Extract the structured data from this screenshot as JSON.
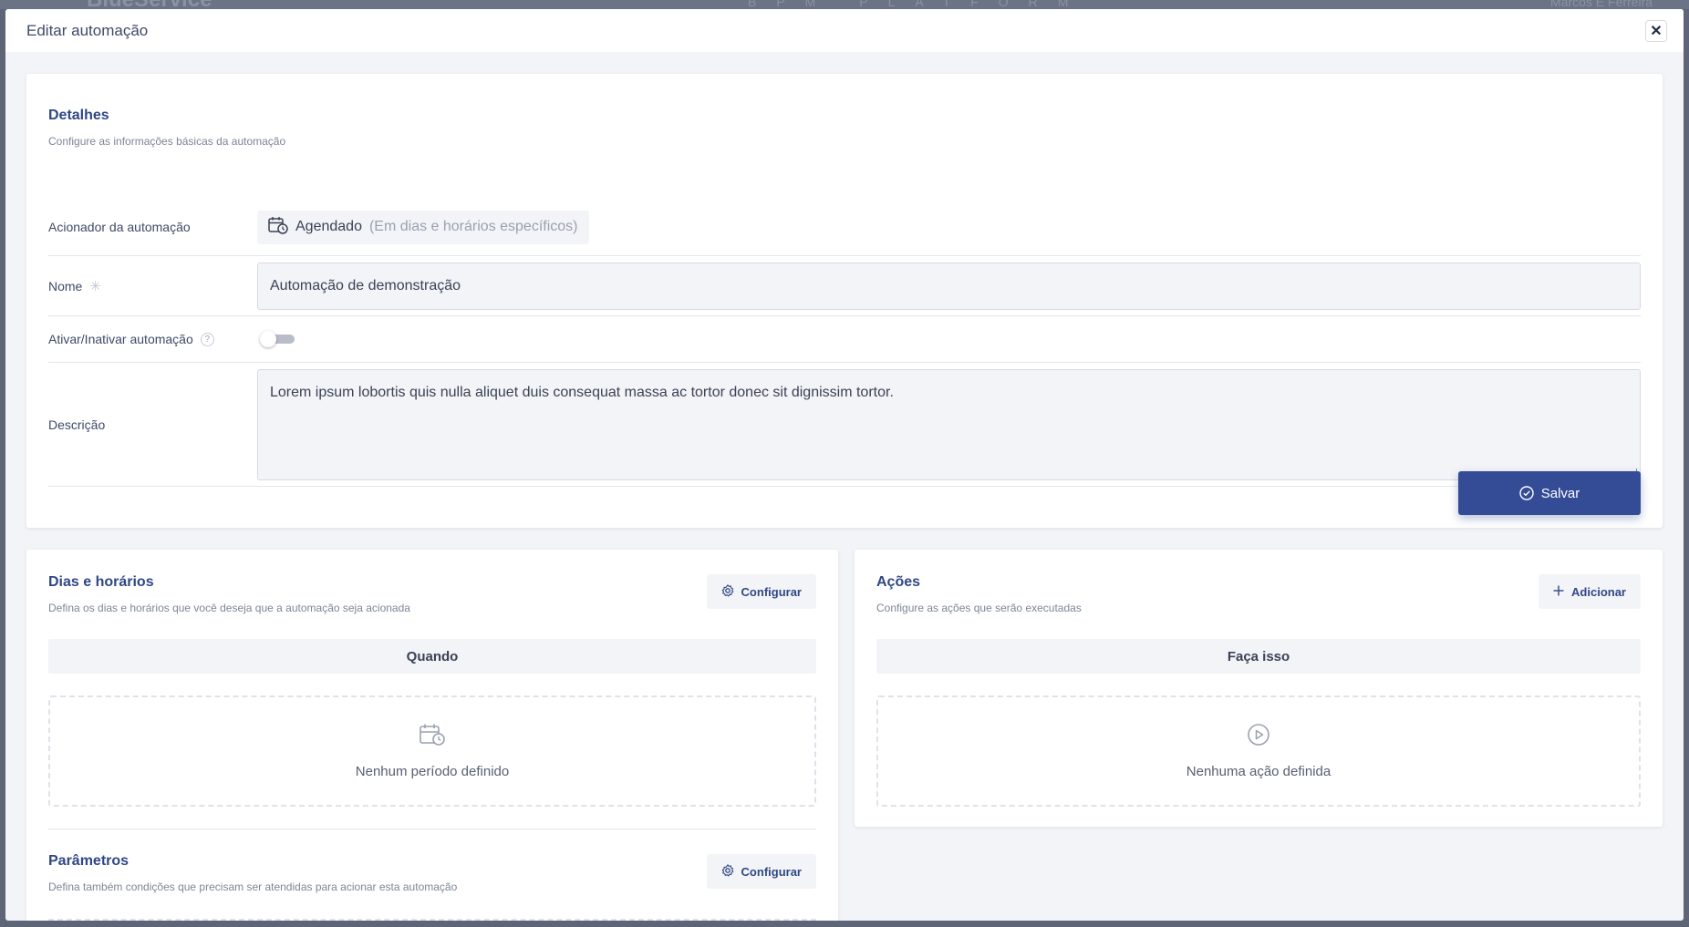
{
  "backdrop": {
    "logo": "BlueService",
    "platform": "BPM PLATFORM",
    "user": "Marcos E Ferreira"
  },
  "modal": {
    "title": "Editar automação",
    "close": "✕"
  },
  "details": {
    "title": "Detalhes",
    "subtitle": "Configure as informações básicas da automação",
    "trigger_label": "Acionador da automação",
    "trigger_value": "Agendado",
    "trigger_hint": "(Em dias e horários específicos)",
    "name_label": "Nome",
    "name_required": "✳",
    "name_value": "Automação de demonstração",
    "toggle_label": "Ativar/Inativar automação",
    "toggle_help": "?",
    "toggle_on": false,
    "description_label": "Descrição",
    "description_value": "Lorem ipsum lobortis quis nulla aliquet duis consequat massa ac tortor donec sit dignissim tortor.",
    "save_label": "Salvar"
  },
  "schedule": {
    "title": "Dias e horários",
    "subtitle": "Defina os dias e horários que você deseja que a automação seja acionada",
    "button": "Configurar",
    "bar": "Quando",
    "empty": "Nenhum período definido"
  },
  "params": {
    "title": "Parâmetros",
    "subtitle": "Defina também condições que precisam ser atendidas para acionar esta automação",
    "button": "Configurar"
  },
  "actions": {
    "title": "Ações",
    "subtitle": "Configure as ações que serão executadas",
    "button": "Adicionar",
    "bar": "Faça isso",
    "empty": "Nenhuma ação definida"
  },
  "colors": {
    "primary": "#344c95",
    "title": "#304785",
    "surface": "#f3f4f8"
  }
}
